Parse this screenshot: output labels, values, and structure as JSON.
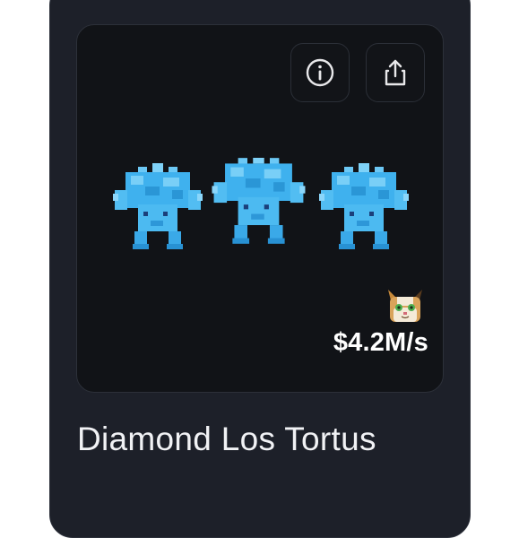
{
  "item": {
    "name": "Diamond Los Tortus",
    "rate": "$4.2M/s"
  },
  "actions": {
    "info_icon": "info-circle-icon",
    "share_icon": "share-upload-icon"
  },
  "colors": {
    "card_background": "#1d2029",
    "media_background": "#111317",
    "creature_blue": "#3fb1ee",
    "text": "#ffffff"
  }
}
